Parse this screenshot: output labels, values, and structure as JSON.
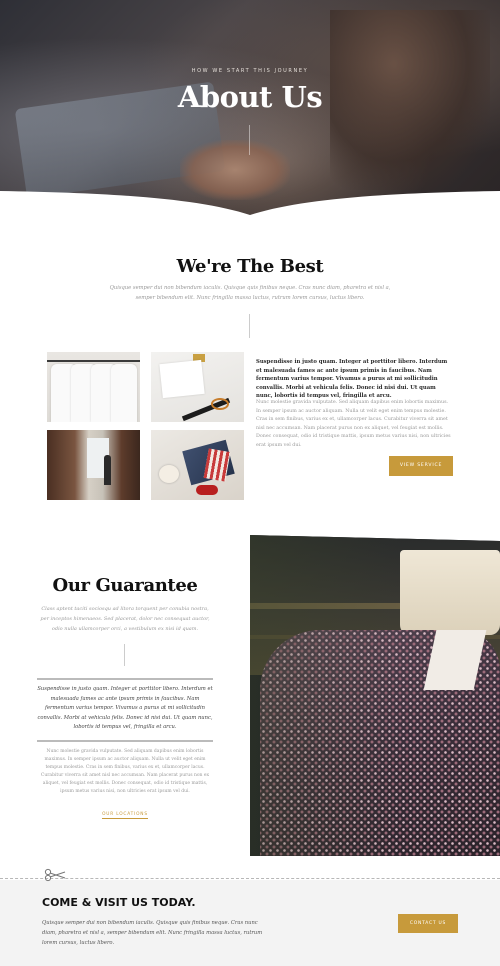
{
  "hero": {
    "kicker": "HOW WE START THIS JOURNEY",
    "title": "About Us"
  },
  "best": {
    "title": "We're The Best",
    "subtitle": "Quisque semper dui non bibendum iaculis. Quisque quis finibus neque. Cras nunc diam, pharetra et nisl a, semper bibendum elit. Nunc fringilla massa luctus, rutrum lorem cursus, luctus libero.",
    "images": [
      "white-shirts-photo",
      "tailoring-tools-photo",
      "clothing-shop-photo",
      "fabric-items-photo"
    ],
    "lead": "Suspendisse in justo quam. Integer at porttitor libero. Interdum et malesuada fames ac ante ipsum primis in faucibus. Nam fermentum varius tempor. Vivamus a purus at mi sollicitudin convallis. Morbi at vehicula felis. Donec id nisi dui. Ut quam nunc, lobortis id tempus vel, fringilla et arcu.",
    "body": "Nunc molestie gravida vulputate. Sed aliquam dapibus enim lobortis maximus. In semper ipsum ac auctor aliquam. Nulla ut velit eget enim tempus molestie. Cras in sem finibus, varius ex et, ullamcorper lacus. Curabitur viverra sit amet nisl nec accumsan. Nam placerat purus non ex aliquet, vel feugiat est mollis. Donec consequat, odio id tristique mattis, ipsum metus varius nisi, non ultricies erat ipsum vel dui.",
    "button": "VIEW SERVICE"
  },
  "guarantee": {
    "title": "Our Guarantee",
    "subtitle": "Class aptent taciti sociosqu ad litora torquent per conubia nostra, per inceptos himenaeos. Sed placerat, dolor nec consequat auctor, odio nulla ullamcorper orci, a vestibulum ex nisi id quam.",
    "quote": "Suspendisse in justo quam. Integer at porttitor libero. Interdum et malesuada fames ac ante ipsum primis in faucibus. Nam fermentum varius tempor. Vivamus a purus at mi sollicitudin convallis. Morbi at vehicula felis. Donec id nisi dui. Ut quam nunc, lobortis id tempus vel, fringilla et arcu.",
    "body": "Nunc molestie gravida vulputate. Sed aliquam dapibus enim lobortis maximus. In semper ipsum ac auctor aliquam. Nulla ut velit eget enim tempus molestie. Cras in sem finibus, varius ex et, ullamcorper lacus. Curabitur viverra sit amet nisl nec accumsan. Nam placerat purus non ex aliquet, vel feugiat est mollis. Donec consequat, odio id tristique mattis, ipsum metus varius nisi, non ultricies erat ipsum vel dui.",
    "link": "OUR LOCATIONS"
  },
  "cta": {
    "title": "COME & VISIT US TODAY.",
    "text": "Quisque semper dui non bibendum iaculis. Quisque quis finibus neque. Cras nunc diam, pharetra et nisl a, semper bibendum elit. Nunc fringilla massa luctus, rutrum lorem cursus, luctus libero.",
    "button": "CONTACT US"
  },
  "colors": {
    "accent": "#c79a3b",
    "heading": "#111111",
    "muted": "#999999",
    "cta_bg": "#f3f3f3"
  }
}
